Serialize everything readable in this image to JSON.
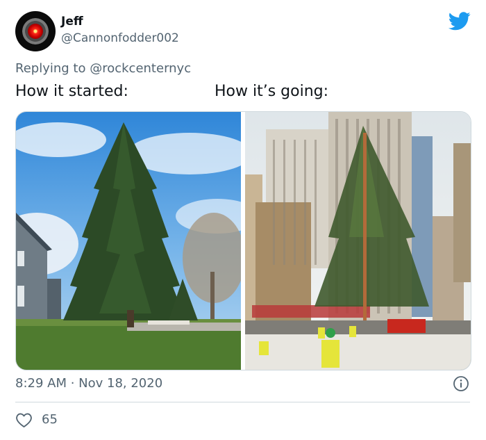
{
  "tweet": {
    "display_name": "Jeff",
    "handle": "@Cannonfodder002",
    "reply_prefix": "Replying to",
    "reply_to": "@rockcenternyc",
    "caption_left": "How it started:",
    "caption_right": "How it’s going:",
    "timestamp": "8:29 AM · Nov 18, 2020",
    "like_count": "65"
  },
  "icons": {
    "avatar": "hal-9000-eye-avatar",
    "brand": "twitter-bird-icon",
    "info": "info-icon",
    "like": "heart-icon"
  },
  "colors": {
    "twitter_blue": "#1d9bf0",
    "secondary_text": "#536471",
    "primary_text": "#0f1419",
    "border": "#cfd9de"
  }
}
